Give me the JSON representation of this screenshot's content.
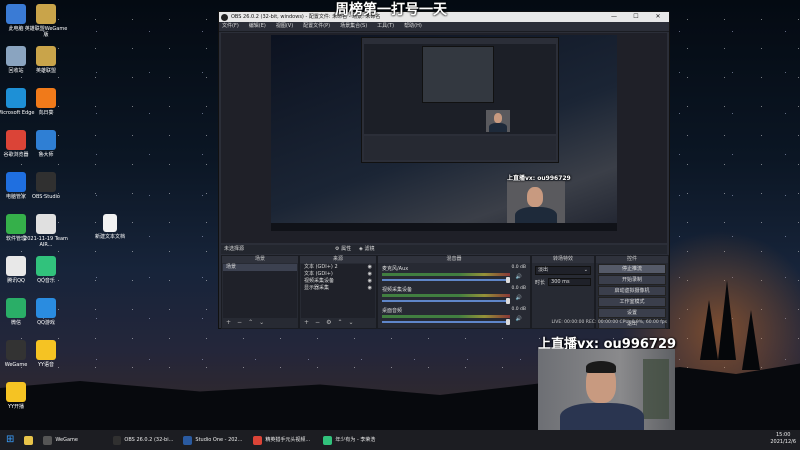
{
  "desktop": {
    "icons": [
      {
        "label": "此电脑",
        "color": "#3a7bd5"
      },
      {
        "label": "英雄联盟WeGame版",
        "color": "#c9a44a"
      },
      {
        "label": "回收站",
        "color": "#8aa4c0"
      },
      {
        "label": "英雄联盟",
        "color": "#c9a44a"
      },
      {
        "label": "Microsoft Edge",
        "color": "#1e90d6"
      },
      {
        "label": "向日葵",
        "color": "#f07a1a"
      },
      {
        "label": "谷歌浏览器",
        "color": "#db4437"
      },
      {
        "label": "鲁大师",
        "color": "#2f7fd4"
      },
      {
        "label": "电脑管家",
        "color": "#1f6fe0"
      },
      {
        "label": "OBS Studio",
        "color": "#303030"
      },
      {
        "label": "软件管理",
        "color": "#35b04a"
      },
      {
        "label": "2021-11-19 Team AIR...",
        "color": "#e0e0e0"
      },
      {
        "label": "腾讯QQ",
        "color": "#e8e8e8"
      },
      {
        "label": "QQ音乐",
        "color": "#31c27c"
      },
      {
        "label": "微信",
        "color": "#2aae67"
      },
      {
        "label": "QQ游戏",
        "color": "#2a8ce0"
      },
      {
        "label": "WeGame",
        "color": "#333333"
      },
      {
        "label": "YY语音",
        "color": "#f5c323"
      },
      {
        "label": "YY开播",
        "color": "#f5c323"
      }
    ],
    "file_icon": {
      "label": "新建文本文档"
    }
  },
  "obs": {
    "title": "OBS 26.0.2 (32-bit, windows) - 配置文件: 未命名 - 场景: 未命名",
    "overlay_title": "周榜第一打号一天",
    "menu": [
      "文件(F)",
      "编辑(E)",
      "视图(V)",
      "配置文件(P)",
      "场景集合(S)",
      "工具(T)",
      "帮助(H)"
    ],
    "window_controls": {
      "minimize": "—",
      "maximize": "☐",
      "close": "✕"
    },
    "scene_bar": {
      "label": "未选择源",
      "props": "属性",
      "filters": "滤镜"
    },
    "docks": {
      "scenes": {
        "title": "场景",
        "items": [
          "场景"
        ]
      },
      "sources": {
        "title": "来源",
        "items": [
          "文本 (GDI+) 2",
          "文本 (GDI+)",
          "视频采集设备",
          "显示器采集"
        ]
      },
      "mixer": {
        "title": "混音器",
        "channels": [
          {
            "name": "麦克风/Aux",
            "db": "0.0 dB"
          },
          {
            "name": "视频采集设备",
            "db": "0.0 dB"
          },
          {
            "name": "桌面音频",
            "db": "0.0 dB"
          }
        ]
      },
      "transitions": {
        "title": "转场特效",
        "type": "淡出",
        "duration_label": "时长",
        "duration": "300 ms"
      },
      "controls": {
        "title": "控件",
        "buttons": [
          "停止推流",
          "开始录制",
          "启动虚拟摄像机",
          "工作室模式",
          "设置",
          "退出"
        ]
      }
    },
    "status": "LIVE: 00:00:00   REC: 00:00:00   CPU: 0.9%, 60.00 fps",
    "inner_cam_text": "上直播vx: ou996729"
  },
  "overlay": {
    "cam_text": "上直播vx: ou996729"
  },
  "taskbar": {
    "items": [
      {
        "label": "WeGame",
        "color": "#555"
      },
      {
        "label": "OBS 26.0.2 (32-bi...",
        "color": "#303030"
      },
      {
        "label": "Studio One - 202...",
        "color": "#2a5aa0"
      },
      {
        "label": "精英猎手元头视频...",
        "color": "#db4437"
      },
      {
        "label": "年少有为 - 李荣浩",
        "color": "#31c27c"
      }
    ],
    "time": "15:00",
    "date": "2021/12/6"
  }
}
